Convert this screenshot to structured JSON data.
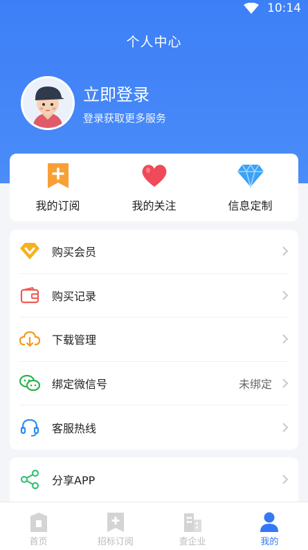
{
  "status_bar": {
    "time": "10:14",
    "wifi_icon": "wifi-icon"
  },
  "header": {
    "title": "个人中心"
  },
  "profile": {
    "login_title": "立即登录",
    "login_subtitle": "登录获取更多服务",
    "avatar_icon": "avatar-illustration"
  },
  "quick_actions": [
    {
      "label": "我的订阅",
      "icon": "bookmark-plus-icon"
    },
    {
      "label": "我的关注",
      "icon": "heart-icon"
    },
    {
      "label": "信息定制",
      "icon": "diamond-icon"
    }
  ],
  "menu_group_1": [
    {
      "label": "购买会员",
      "value": "",
      "icon": "vip-icon"
    },
    {
      "label": "购买记录",
      "value": "",
      "icon": "wallet-icon"
    },
    {
      "label": "下载管理",
      "value": "",
      "icon": "cloud-download-icon"
    },
    {
      "label": "绑定微信号",
      "value": "未绑定",
      "icon": "wechat-icon"
    },
    {
      "label": "客服热线",
      "value": "",
      "icon": "headset-icon"
    }
  ],
  "menu_group_2": [
    {
      "label": "分享APP",
      "value": "",
      "icon": "share-icon"
    }
  ],
  "tabbar": [
    {
      "label": "首页",
      "icon": "home-icon",
      "active": false
    },
    {
      "label": "招标订阅",
      "icon": "subscribe-icon",
      "active": false
    },
    {
      "label": "查企业",
      "icon": "building-icon",
      "active": false
    },
    {
      "label": "我的",
      "icon": "user-icon",
      "active": true
    }
  ],
  "colors": {
    "primary": "#3d7ff7",
    "active_tab": "#3478f6",
    "inactive_tab": "#bbbbbb"
  }
}
